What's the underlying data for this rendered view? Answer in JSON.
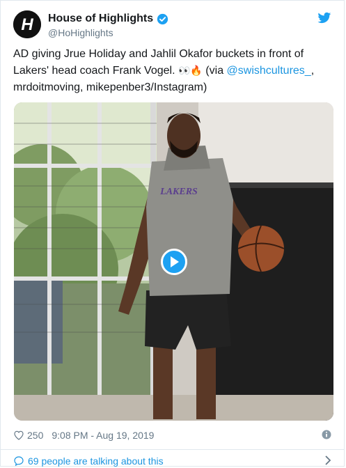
{
  "tweet": {
    "display_name": "House of Highlights",
    "handle": "@HoHighlights",
    "text_before": "AD giving Jrue Holiday and Jahlil Okafor buckets in front of Lakers' head coach Frank Vogel. ",
    "emojis": "👀🔥",
    "text_via": " (via ",
    "mention": "@swishcultures_",
    "text_after": ", mrdoitmoving, mikepenber3/Instagram)"
  },
  "media": {
    "jersey_text": "LAKERS"
  },
  "meta": {
    "likes": "250",
    "timestamp": "9:08 PM - Aug 19, 2019"
  },
  "footer": {
    "talking": "69 people are talking about this"
  },
  "colors": {
    "link": "#1b95e0",
    "verified": "#1da1f2",
    "secondary_text": "#657786"
  },
  "icons": [
    "hoh-logo-icon",
    "verified-icon",
    "twitter-bird-icon",
    "play-icon",
    "heart-icon",
    "info-icon",
    "comment-bubble-icon",
    "chevron-right-icon"
  ]
}
